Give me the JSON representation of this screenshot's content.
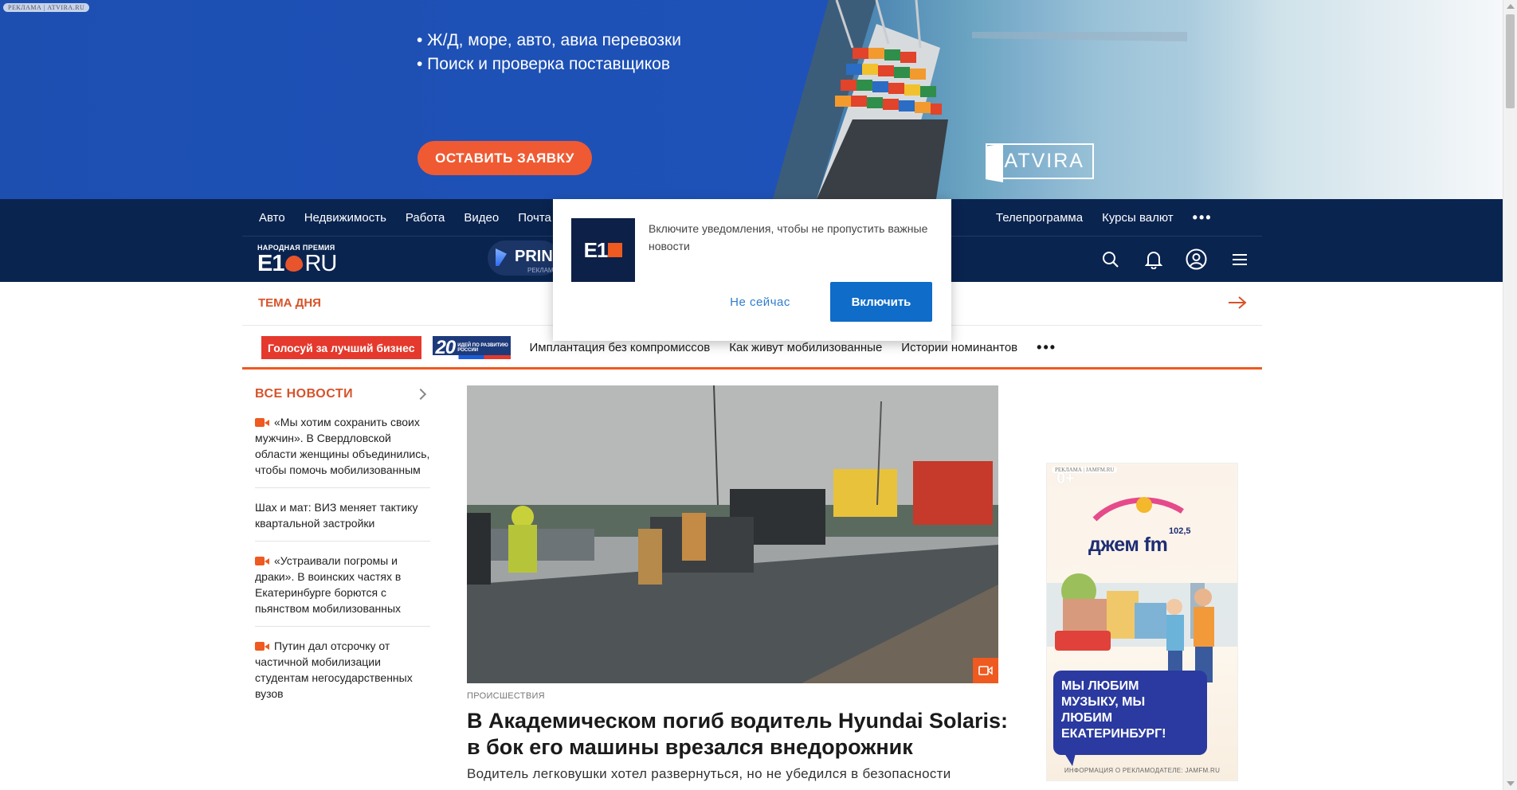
{
  "banner": {
    "ad_tag": "РЕКЛАМА | ATVIRA.RU",
    "bullets": [
      "• Ж/Д, море, авто, авиа перевозки",
      "• Поиск и проверка поставщиков"
    ],
    "cta": "ОСТАВИТЬ ЗАЯВКУ",
    "brand": "ATVIRA"
  },
  "nav": {
    "items": [
      "Авто",
      "Недвижимость",
      "Работа",
      "Видео",
      "Почта",
      "",
      "",
      "",
      "",
      "",
      "Телепрограмма",
      "Курсы валют"
    ],
    "more": "•••"
  },
  "logo": {
    "prize": "НАРОДНАЯ ПРЕМИЯ",
    "e1": "E1",
    "ru": "RU"
  },
  "prime": {
    "text": "PRIN",
    "ad": "РЕКЛАМ"
  },
  "header_icons": [
    "search-icon",
    "bell-icon",
    "user-icon",
    "menu-icon"
  ],
  "theme": {
    "label": "ТЕМА ДНЯ"
  },
  "tags": {
    "vote": "Голосуй за лучший бизнес",
    "twenty_num": "20",
    "twenty_text": "ИДЕЙ ПО РАЗВИТИЮ РОССИИ",
    "links": [
      "Имплантация без компромиссов",
      "Как живут мобилизованные",
      "Истории номинантов"
    ],
    "more": "•••"
  },
  "sidebar": {
    "title": "ВСЕ НОВОСТИ",
    "items": [
      {
        "text": "«Мы хотим сохранить своих мужчин». В Свердловской области женщины объединились, чтобы помочь мобилизованным",
        "video": true
      },
      {
        "text": "Шах и мат: ВИЗ меняет тактику квартальной застройки",
        "video": false
      },
      {
        "text": "«Устраивали погромы и драки». В воинских частях в Екатеринбурге борются с пьянством мобилизованных",
        "video": true
      },
      {
        "text": "Путин дал отсрочку от частичной мобилизации студентам негосударственных вузов",
        "video": true
      }
    ]
  },
  "article": {
    "category": "ПРОИСШЕСТВИЯ",
    "headline": "В Академическом погиб водитель Hyundai Solaris: в бок его машины врезался внедорожник",
    "lead": "Водитель легковушки хотел развернуться, но не убедился в безопасности"
  },
  "right_ad": {
    "tag": "РЕКЛАМА | JAMFM.RU",
    "age": "0+",
    "brand": "джем fm",
    "freq": "102,5",
    "slogan": "Мы любим музыку, мы любим Екатеринбург!",
    "info": "ИНФОРМАЦИЯ О РЕКЛАМОДАТЕЛЕ: JAMFM.RU"
  },
  "popup": {
    "icon_text": "E1",
    "message": "Включите уведомления, чтобы не пропустить важные новости",
    "later": "Не сейчас",
    "enable": "Включить"
  },
  "colors": {
    "navy": "#0a2450",
    "accent": "#ee5a1f",
    "blue_button": "#0f6cc8"
  }
}
